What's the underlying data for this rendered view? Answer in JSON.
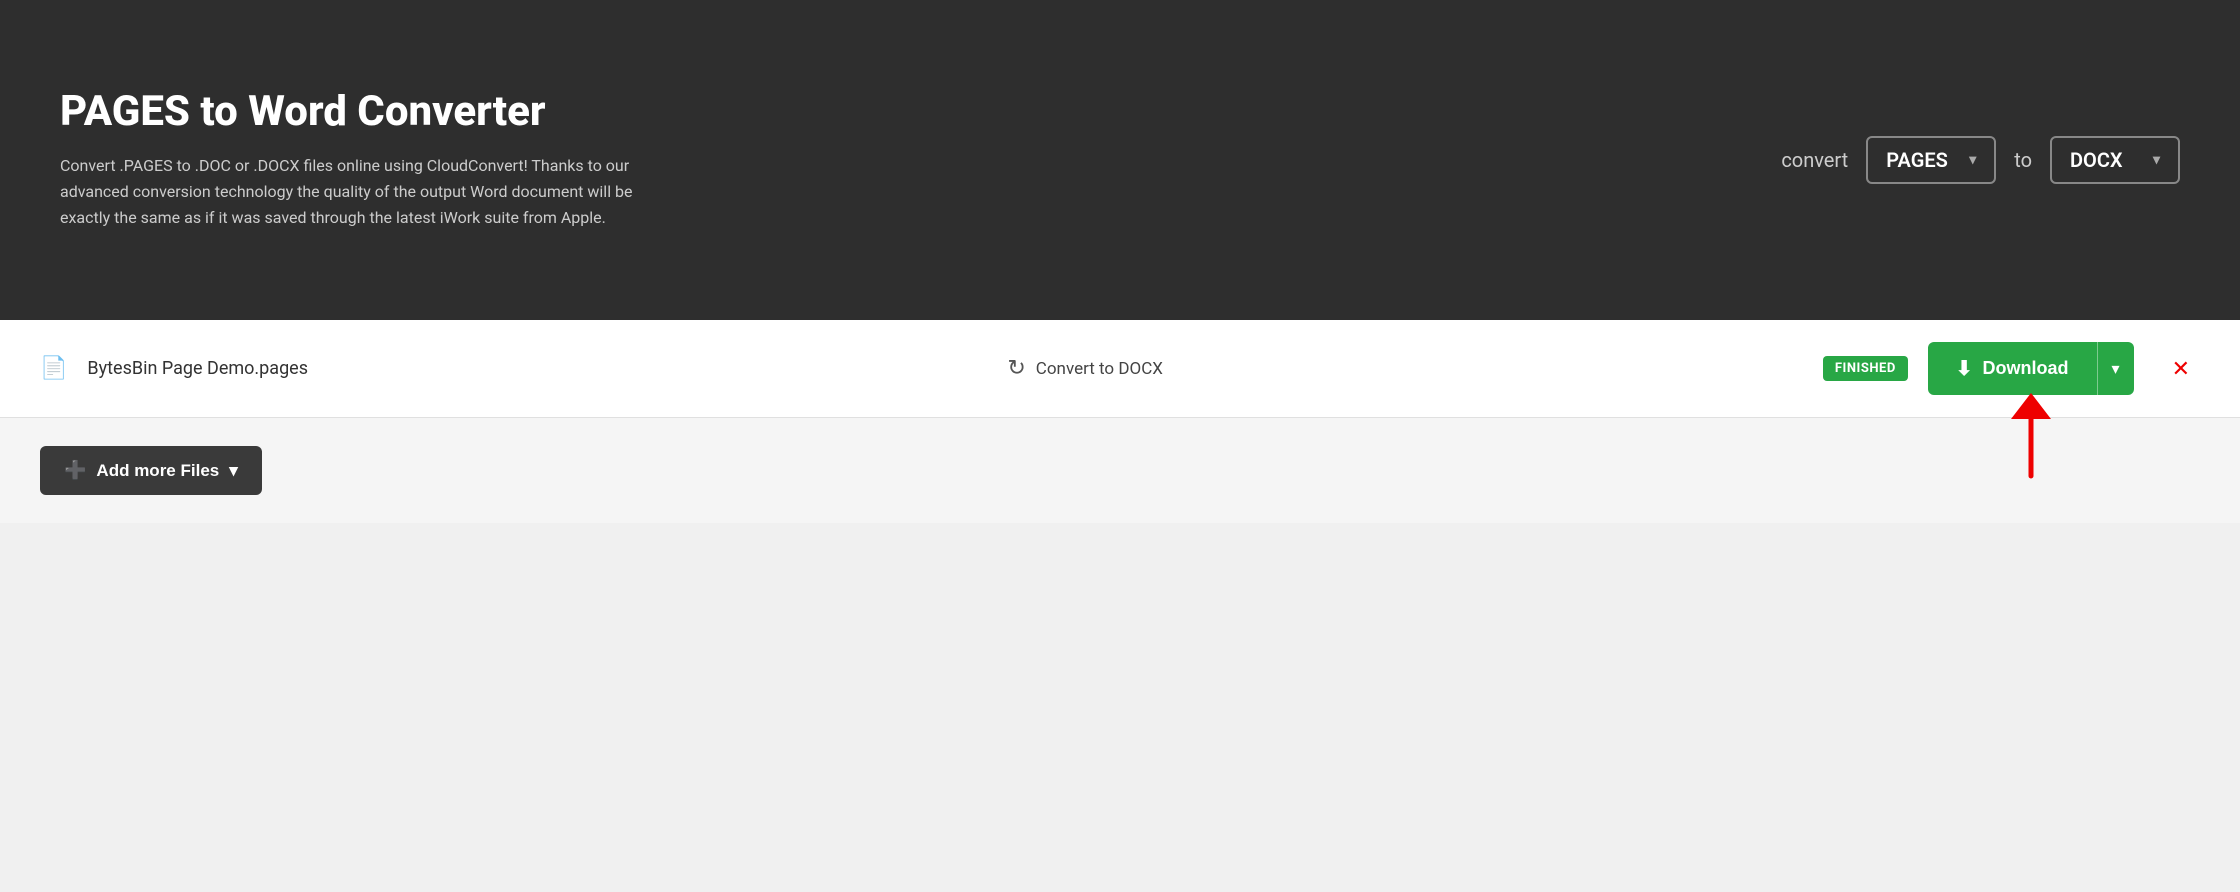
{
  "hero": {
    "title": "PAGES to Word Converter",
    "description": "Convert .PAGES to .DOC or .DOCX files online using CloudConvert! Thanks to our advanced conversion technology the quality of the output Word document will be exactly the same as if it was saved through the latest iWork suite from Apple.",
    "converter": {
      "label_convert": "convert",
      "from_format": "PAGES",
      "label_to": "to",
      "to_format": "DOCX"
    }
  },
  "file_row": {
    "file_name": "BytesBin Page Demo.pages",
    "convert_label": "Convert to DOCX",
    "status": "FINISHED",
    "download_label": "Download"
  },
  "add_files": {
    "label": "Add more Files"
  }
}
